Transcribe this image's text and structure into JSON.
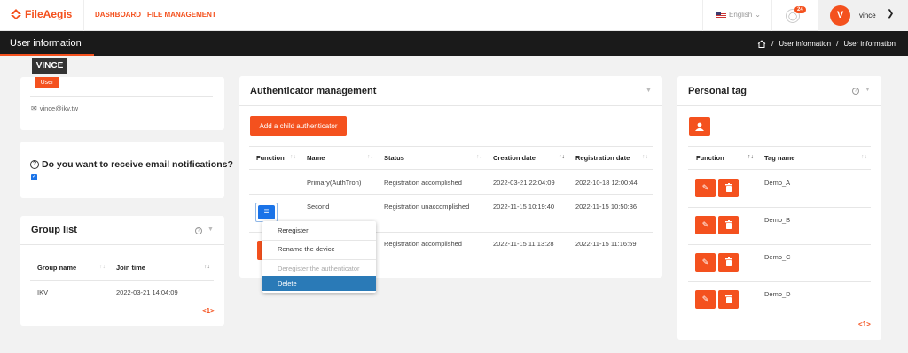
{
  "topbar": {
    "logo_text": "FileAegis",
    "nav": [
      "DASHBOARD",
      "FILE MANAGEMENT"
    ],
    "language": "English",
    "notifications_count": "24",
    "avatar_initial": "V",
    "user_name": "vince"
  },
  "header": {
    "title": "User information",
    "breadcrumb": [
      "User information",
      "User information"
    ]
  },
  "profile": {
    "name": "VINCE",
    "role": "User",
    "email": "vince@ikv.tw"
  },
  "notifications": {
    "question": "Do you want to receive email notifications?",
    "checked": true
  },
  "group_list": {
    "title": "Group list",
    "columns": [
      "Group name",
      "Join time"
    ],
    "rows": [
      [
        "IKV",
        "2022-03-21 14:04:09"
      ]
    ],
    "pager": "<1>"
  },
  "authenticator": {
    "title": "Authenticator management",
    "add_button": "Add a child authenticator",
    "columns": [
      "Function",
      "Name",
      "Status",
      "Creation date",
      "Registration date"
    ],
    "rows": [
      {
        "name": "Primary(AuthTron)",
        "status": "Registration accomplished",
        "created": "2022-03-21 22:04:09",
        "registered": "2022-10-18 12:00:44"
      },
      {
        "name": "Second",
        "status": "Registration unaccomplished",
        "created": "2022-11-15 10:19:40",
        "registered": "2022-11-15 10:50:36"
      },
      {
        "name": "",
        "status": "Registration accomplished",
        "created": "2022-11-15 11:13:28",
        "registered": "2022-11-15 11:16:59"
      }
    ],
    "menu": [
      "Reregister",
      "Rename the device",
      "Deregister the authenticator",
      "Delete"
    ]
  },
  "personal_tag": {
    "title": "Personal tag",
    "columns": [
      "Function",
      "Tag name"
    ],
    "tags": [
      "Demo_A",
      "Demo_B",
      "Demo_C",
      "Demo_D"
    ],
    "pager": "<1>"
  },
  "colors": {
    "accent": "#f4511e",
    "header": "#1a1a1a",
    "menu_selected": "#2a7ab7"
  }
}
